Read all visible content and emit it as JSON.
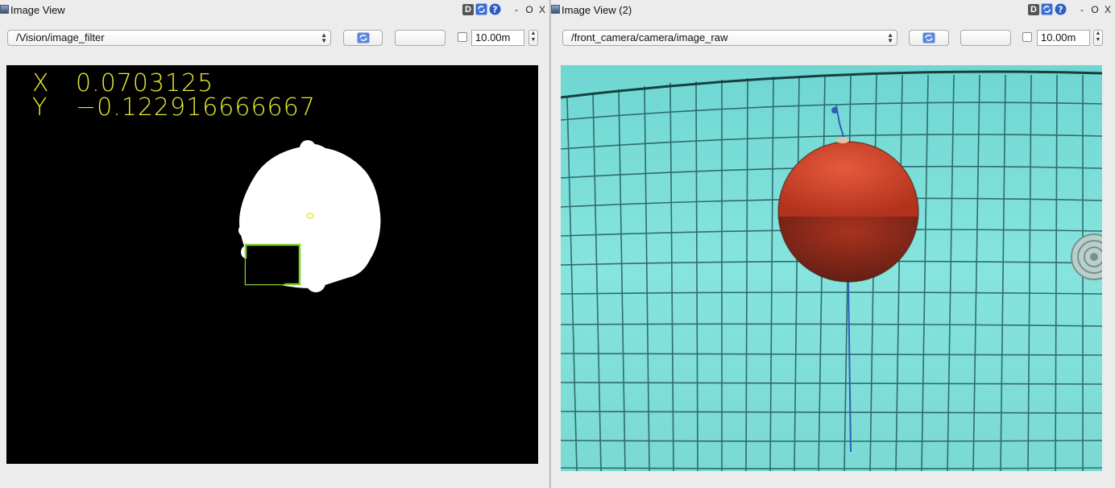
{
  "left_panel": {
    "title": "Image View",
    "title_buttons": {
      "dock": "D",
      "minimize": "-",
      "float": "O",
      "close": "X"
    },
    "topic": "/Vision/image_filter",
    "timeout_value": "10.00m",
    "overlay": {
      "x_label": "X",
      "x_value": "0.0703125",
      "y_label": "Y",
      "y_value": "−0.122916666667",
      "text_color": "#e8e833",
      "roi_box_color": "#7fd12a"
    }
  },
  "right_panel": {
    "title": "Image View (2)",
    "title_buttons": {
      "dock": "D",
      "minimize": "-",
      "float": "O",
      "close": "X"
    },
    "topic": "/front_camera/camera/image_raw",
    "timeout_value": "10.00m"
  },
  "icons": {
    "refresh": "refresh-icon",
    "help": "help-icon",
    "window": "window-icon"
  },
  "colors": {
    "pool_water": "#7fe0da",
    "buoy": "#c8402a",
    "tile_grid": "#1f4d50"
  }
}
